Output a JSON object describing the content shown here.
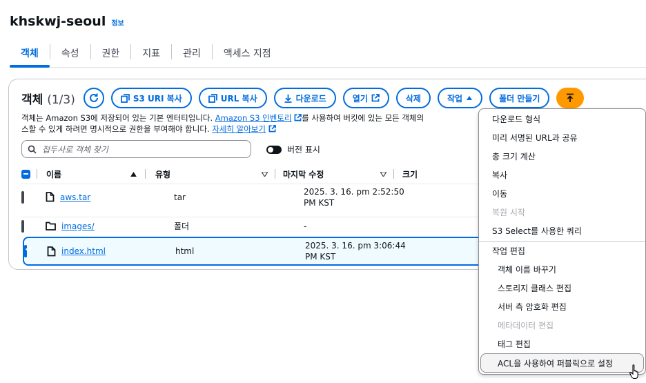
{
  "header": {
    "title": "khskwj-seoul",
    "info": "정보"
  },
  "tabs": [
    "객체",
    "속성",
    "권한",
    "지표",
    "관리",
    "액세스 지점"
  ],
  "panel": {
    "title": "객체",
    "count": "(1/3)",
    "buttons": {
      "refresh_icon": "refresh-icon",
      "copy_s3_uri": "S3 URI 복사",
      "copy_url": "URL 복사",
      "download": "다운로드",
      "open": "열기",
      "delete": "삭제",
      "actions": "작업",
      "create_folder": "폴더 만들기",
      "upload_icon": "upload-icon"
    },
    "description": {
      "text1": "객체는 Amazon S3에 저장되어 있는 기본 엔터티입니다. ",
      "link1": "Amazon S3 인벤토리",
      "text2": "를 사용하여 버킷에 있는 모든 객체의",
      "text3": "스할 수 있게 하려면 명시적으로 권한을 부여해야 합니다. ",
      "link2": "자세히 알아보기"
    },
    "search": {
      "placeholder": "접두사로 객체 찾기"
    },
    "version_toggle": "버전 표시",
    "columns": {
      "name": "이름",
      "type": "유형",
      "modified": "마지막 수정",
      "size": "크기"
    },
    "rows": [
      {
        "name": "aws.tar",
        "type": "tar",
        "modified_line1": "2025. 3. 16. pm 2:52:50",
        "modified_line2": "PM KST",
        "selected": false,
        "icon": "file-icon"
      },
      {
        "name": "images/",
        "type": "폴더",
        "modified_line1": "-",
        "modified_line2": "",
        "selected": false,
        "icon": "folder-icon"
      },
      {
        "name": "index.html",
        "type": "html",
        "modified_line1": "2025. 3. 16. pm 3:06:44",
        "modified_line2": "PM KST",
        "selected": true,
        "icon": "file-icon"
      }
    ]
  },
  "actions_menu": {
    "items": [
      {
        "label": "다운로드 형식",
        "disabled": false
      },
      {
        "label": "미리 서명된 URL과 공유",
        "disabled": false
      },
      {
        "label": "총 크기 계산",
        "disabled": false
      },
      {
        "label": "복사",
        "disabled": false
      },
      {
        "label": "이동",
        "disabled": false
      },
      {
        "label": "복원 시작",
        "disabled": true
      },
      {
        "label": "S3 Select를 사용한 쿼리",
        "disabled": false
      }
    ],
    "group_label": "작업 편집",
    "edit_items": [
      {
        "label": "객체 이름 바꾸기",
        "disabled": false
      },
      {
        "label": "스토리지 클래스 편집",
        "disabled": false
      },
      {
        "label": "서버 측 암호화 편집",
        "disabled": false
      },
      {
        "label": "메타데이터 편집",
        "disabled": true
      },
      {
        "label": "태그 편집",
        "disabled": false
      },
      {
        "label": "ACL을 사용하여 퍼블릭으로 설정",
        "disabled": false,
        "hovered": true
      }
    ]
  },
  "colors": {
    "accent": "#006ce0",
    "primary_button": "#ff9900",
    "text": "#0f141a",
    "disabled": "#a8a8b0"
  }
}
